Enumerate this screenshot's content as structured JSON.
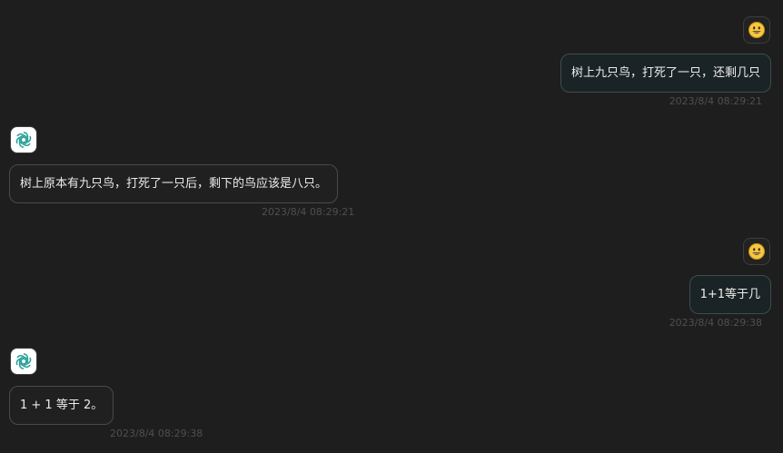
{
  "messages": [
    {
      "role": "user",
      "avatar_icon": "smiley-face-icon",
      "text": "树上九只鸟，打死了一只，还剩几只",
      "time": "2023/8/4 08:29:21"
    },
    {
      "role": "assistant",
      "avatar_icon": "openai-logo-icon",
      "text": "树上原本有九只鸟，打死了一只后，剩下的鸟应该是八只。",
      "time": "2023/8/4 08:29:21"
    },
    {
      "role": "user",
      "avatar_icon": "smiley-face-icon",
      "text": "1+1等于几",
      "time": "2023/8/4 08:29:38"
    },
    {
      "role": "assistant",
      "avatar_icon": "openai-logo-icon",
      "text": "1 + 1 等于 2。",
      "time": "2023/8/4 08:29:38"
    }
  ],
  "colors": {
    "background": "#1e1e1e",
    "user_bubble": "#1a2325",
    "user_bubble_border": "#3e4c51",
    "bot_bubble_border": "#4a4a4a",
    "timestamp": "#4f4f4f",
    "openai_logo": "#2aa198"
  }
}
